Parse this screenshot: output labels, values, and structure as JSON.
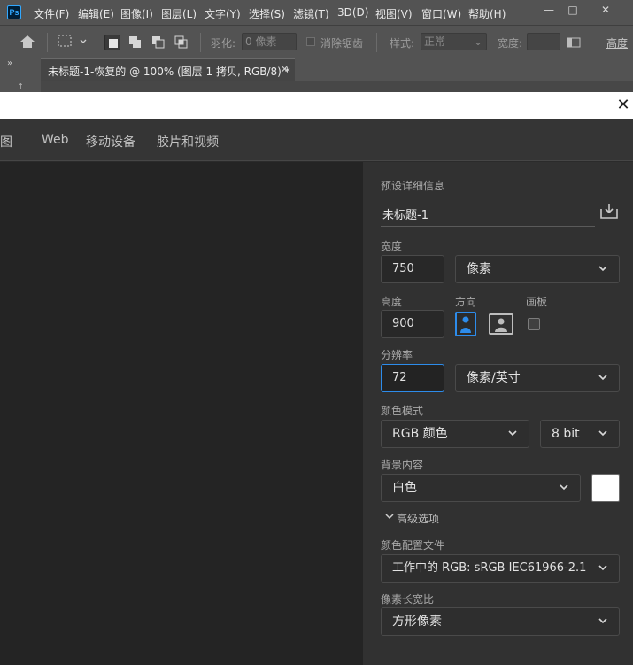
{
  "ps": {
    "logo_text": "Ps",
    "menu": [
      "文件(F)",
      "编辑(E)",
      "图像(I)",
      "图层(L)",
      "文字(Y)",
      "选择(S)",
      "滤镜(T)",
      "3D(D)",
      "视图(V)",
      "窗口(W)",
      "帮助(H)"
    ],
    "window_controls": {
      "minimize": "—",
      "restore": "□",
      "close": "✕"
    },
    "options": {
      "feather_label": "羽化:",
      "feather_value": "0 像素",
      "antialias_label": "消除锯齿",
      "style_label": "样式:",
      "style_value": "正常",
      "width_label": "宽度:",
      "more": "高度"
    },
    "collapse_arrows": "»",
    "doc_tab": {
      "title": "未标题-1-恢复的 @ 100% (图层 1 拷贝, RGB/8) *",
      "close": "×"
    }
  },
  "dialog": {
    "close": "✕",
    "tabs": [
      "插图",
      "Web",
      "移动设备",
      "胶片和视频"
    ],
    "details": {
      "heading": "预设详细信息",
      "doc_name": "未标题-1",
      "width_label": "宽度",
      "width_value": "750",
      "width_unit": "像素",
      "height_label": "高度",
      "height_value": "900",
      "orientation_label": "方向",
      "artboard_label": "画板",
      "resolution_label": "分辨率",
      "resolution_value": "72",
      "resolution_unit": "像素/英寸",
      "color_mode_label": "颜色模式",
      "color_mode_value": "RGB 颜色",
      "bit_depth": "8 bit",
      "background_label": "背景内容",
      "background_value": "白色",
      "advanced_label": "高级选项",
      "profile_label": "颜色配置文件",
      "profile_value": "工作中的 RGB: sRGB IEC61966-2.1",
      "pixel_aspect_label": "像素长宽比",
      "pixel_aspect_value": "方形像素"
    }
  },
  "colors": {
    "accent_blue": "#2d8ceb",
    "background_swatch": "#ffffff"
  }
}
